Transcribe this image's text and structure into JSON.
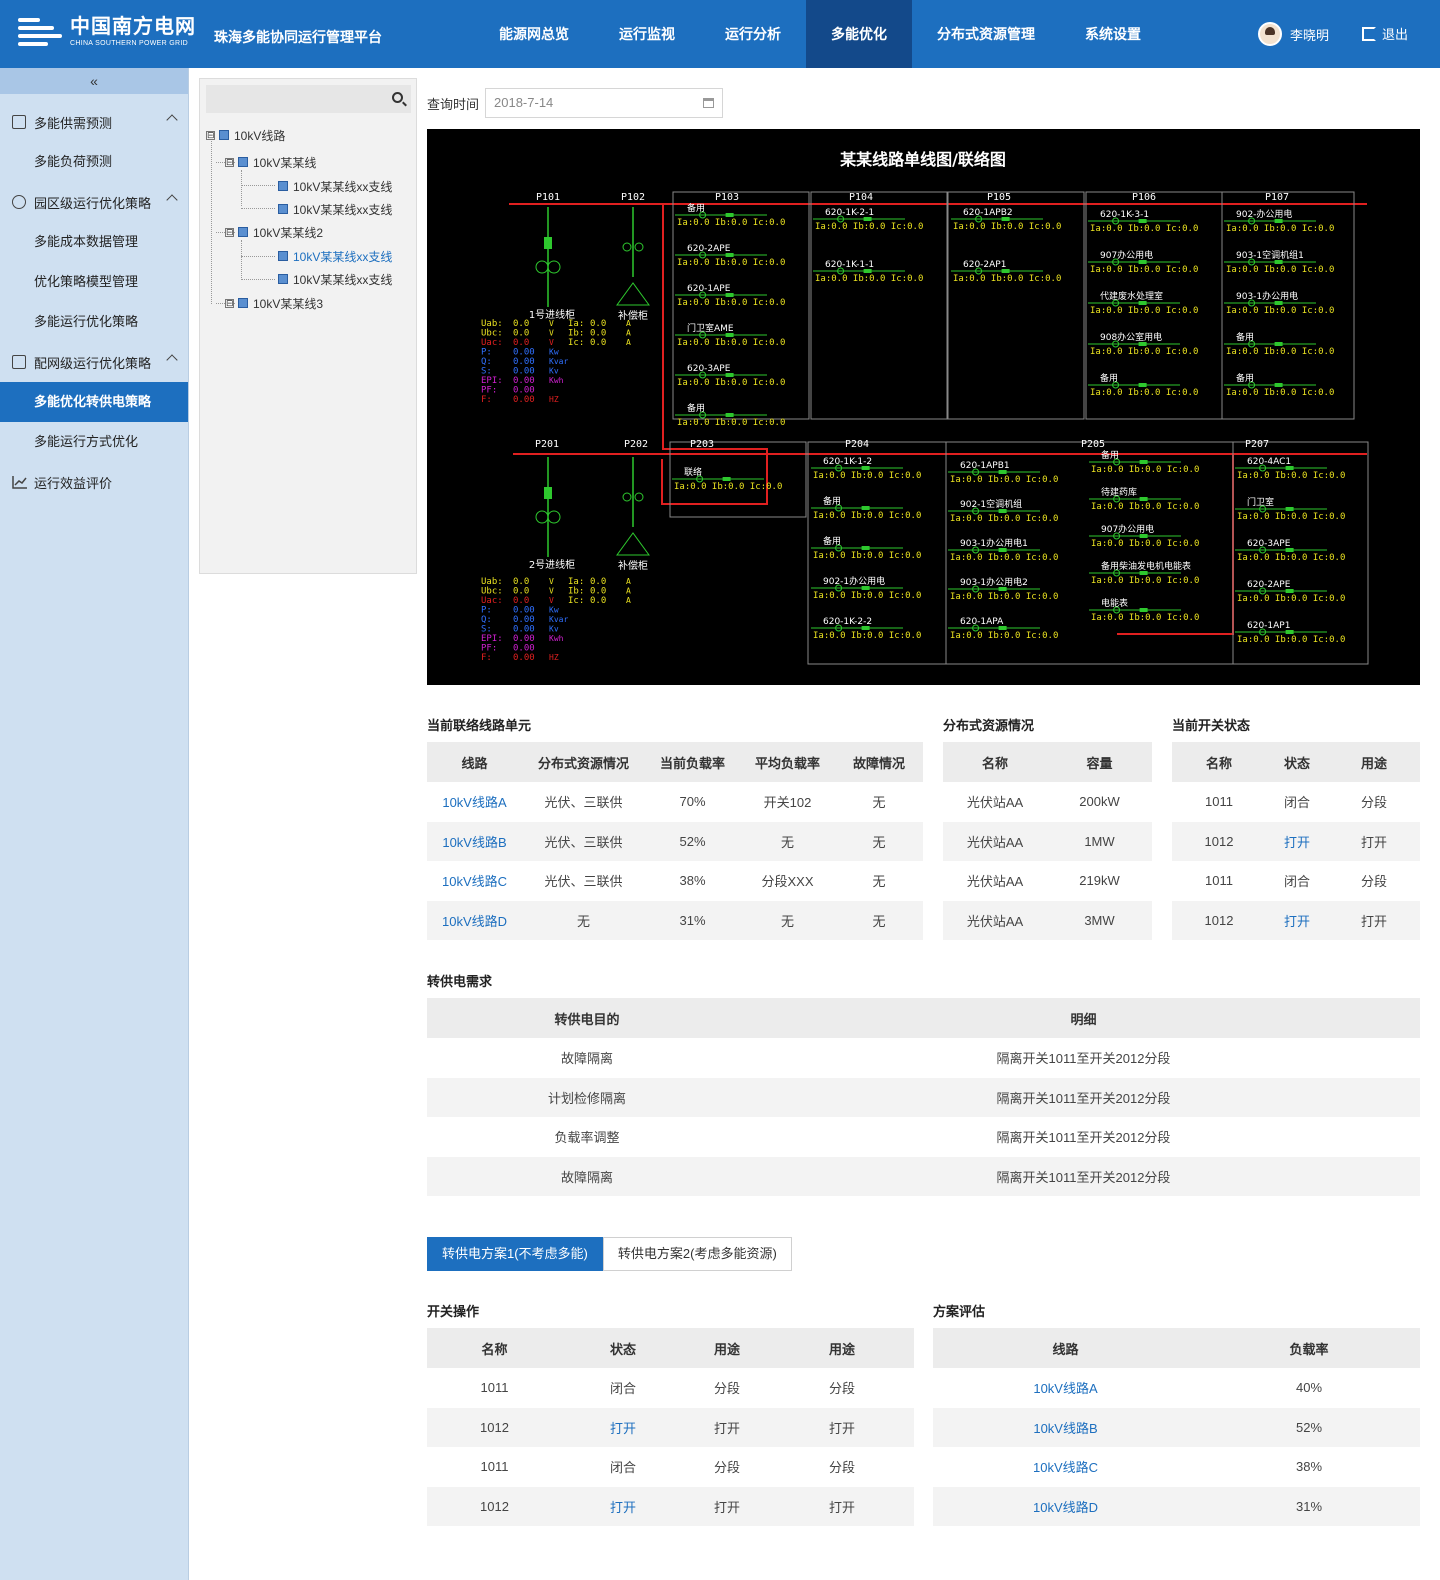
{
  "header": {
    "logo_cn": "中国南方电网",
    "logo_en": "CHINA SOUTHERN POWER GRID",
    "platform": "珠海多能协同运行管理平台",
    "nav": [
      "能源网总览",
      "运行监视",
      "运行分析",
      "多能优化",
      "分布式资源管理",
      "系统设置"
    ],
    "active_nav": "多能优化",
    "user": "李晓明",
    "logout": "退出"
  },
  "sidebar": {
    "collapse": "«",
    "groups": [
      {
        "label": "多能供需预测",
        "items": [
          "多能负荷预测"
        ]
      },
      {
        "label": "园区级运行优化策略",
        "items": [
          "多能成本数据管理",
          "优化策略模型管理",
          "多能运行优化策略"
        ]
      },
      {
        "label": "配网级运行优化策略",
        "items": [
          "多能优化转供电策略",
          "多能运行方式优化"
        ]
      },
      {
        "label": "运行效益评价",
        "items": []
      }
    ],
    "active_item": "多能优化转供电策略"
  },
  "tree": {
    "search_placeholder": "",
    "nodes": [
      {
        "label": "10kV线路",
        "level": 0,
        "toggle": "⊟"
      },
      {
        "label": "10kV某某线",
        "level": 1,
        "toggle": "⊟"
      },
      {
        "label": "10kV某某线xx支线",
        "level": 2
      },
      {
        "label": "10kV某某线xx支线",
        "level": 2
      },
      {
        "label": "10kV某某线2",
        "level": 1,
        "toggle": "⊟"
      },
      {
        "label": "10kV某某线xx支线",
        "level": 2,
        "selected": true
      },
      {
        "label": "10kV某某线xx支线",
        "level": 2
      },
      {
        "label": "10kV某某线3",
        "level": 1,
        "toggle": "⊟"
      }
    ]
  },
  "query": {
    "label": "查询时间",
    "date": "2018-7-14"
  },
  "diagram": {
    "title": "某某线路单线图/联络图",
    "top_cabinets": [
      "P101",
      "P102",
      "P103",
      "P104",
      "P105",
      "P106",
      "P107"
    ],
    "bottom_cabinets": [
      "P201",
      "P202",
      "P203",
      "P204",
      "P205",
      "P207"
    ],
    "incoming1": "1号进线柜",
    "incoming2": "2号进线柜",
    "compensator": "补偿柜",
    "meter_labels": [
      "Uab:",
      "Ubc:",
      "Uac:",
      "P:",
      "Q:",
      "S:",
      "EPI:",
      "PF:",
      "F:"
    ],
    "meter_values": [
      "0.0",
      "0.0",
      "0.0",
      "0.00",
      "0.00",
      "0.00",
      "0.00",
      "0.00",
      "0.00"
    ],
    "meter_units": [
      "V",
      "V",
      "V",
      "Kw",
      "Kvar",
      "Kv",
      "Kwh",
      "",
      "HZ"
    ],
    "current_labels": [
      "Ia:",
      "Ib:",
      "Ic:"
    ],
    "current_values": [
      "0.0",
      "0.0",
      "0.0"
    ],
    "current_units": [
      "A",
      "A",
      "A"
    ],
    "reading": "Ia:0.0  Ib:0.0  Ic:0.0",
    "feeders": {
      "P103": [
        "备用",
        "620-2APE",
        "620-1APE",
        "门卫室AME",
        "620-3APE",
        "备用"
      ],
      "P104": [
        "620-1K-2-1",
        "620-1K-1-1"
      ],
      "P105": [
        "620-1APB2",
        "620-2AP1"
      ],
      "P106": [
        "620-1K-3-1",
        "907办公用电",
        "代建废水处理室",
        "908办公室用电",
        "备用"
      ],
      "P107": [
        "902-办公用电",
        "903-1空调机组1",
        "903-1办公用电",
        "备用",
        "备用"
      ],
      "P203": [
        "联络"
      ],
      "P204": [
        "620-1K-1-2",
        "备用",
        "备用",
        "902-1办公用电",
        "620-1K-2-2"
      ],
      "P205": [
        "620-1APB1",
        "902-1空调机组",
        "903-1办公用电1",
        "903-1办公用电2",
        "620-1APA",
        "备用",
        "待建药库",
        "907办公用电",
        "备用柴油发电机电能表",
        "电能表"
      ],
      "P207": [
        "620-4AC1",
        "门卫室",
        "620-3APE",
        "620-2APE",
        "620-1AP1"
      ]
    }
  },
  "tie_units": {
    "title": "当前联络线路单元",
    "headers": [
      "线路",
      "分布式资源情况",
      "当前负载率",
      "平均负载率",
      "故障情况"
    ],
    "rows": [
      [
        "10kV线路A",
        "光伏、三联供",
        "70%",
        "开关102",
        "无"
      ],
      [
        "10kV线路B",
        "光伏、三联供",
        "52%",
        "无",
        "无"
      ],
      [
        "10kV线路C",
        "光伏、三联供",
        "38%",
        "分段XXX",
        "无"
      ],
      [
        "10kV线路D",
        "无",
        "31%",
        "无",
        "无"
      ]
    ]
  },
  "der": {
    "title": "分布式资源情况",
    "headers": [
      "名称",
      "容量"
    ],
    "rows": [
      [
        "光伏站AA",
        "200kW"
      ],
      [
        "光伏站AA",
        "1MW"
      ],
      [
        "光伏站AA",
        "219kW"
      ],
      [
        "光伏站AA",
        "3MW"
      ]
    ]
  },
  "switch_status": {
    "title": "当前开关状态",
    "headers": [
      "名称",
      "状态",
      "用途"
    ],
    "rows": [
      [
        "1011",
        "闭合",
        "分段"
      ],
      [
        "1012",
        "打开",
        "打开"
      ],
      [
        "1011",
        "闭合",
        "分段"
      ],
      [
        "1012",
        "打开",
        "打开"
      ]
    ]
  },
  "demand": {
    "title": "转供电需求",
    "headers": [
      "转供电目的",
      "明细"
    ],
    "rows": [
      [
        "故障隔离",
        "隔离开关1011至开关2012分段"
      ],
      [
        "计划检修隔离",
        "隔离开关1011至开关2012分段"
      ],
      [
        "负载率调整",
        "隔离开关1011至开关2012分段"
      ],
      [
        "故障隔离",
        "隔离开关1011至开关2012分段"
      ]
    ]
  },
  "plan_tabs": [
    "转供电方案1(不考虑多能)",
    "转供电方案2(考虑多能资源)"
  ],
  "switch_ops": {
    "title": "开关操作",
    "headers": [
      "名称",
      "状态",
      "用途",
      "用途"
    ],
    "rows": [
      [
        "1011",
        "闭合",
        "分段",
        "分段"
      ],
      [
        "1012",
        "打开",
        "打开",
        "打开"
      ],
      [
        "1011",
        "闭合",
        "分段",
        "分段"
      ],
      [
        "1012",
        "打开",
        "打开",
        "打开"
      ]
    ]
  },
  "evaluation": {
    "title": "方案评估",
    "headers": [
      "线路",
      "负载率"
    ],
    "rows": [
      [
        "10kV线路A",
        "40%"
      ],
      [
        "10kV线路B",
        "52%"
      ],
      [
        "10kV线路C",
        "38%"
      ],
      [
        "10kV线路D",
        "31%"
      ]
    ]
  }
}
